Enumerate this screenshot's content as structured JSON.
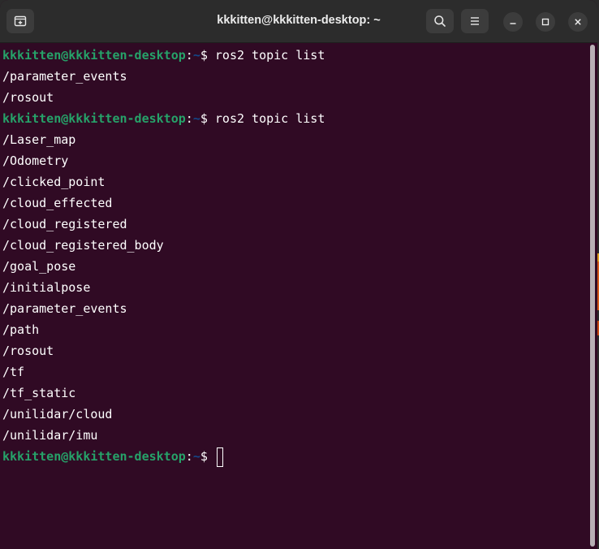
{
  "window": {
    "title": "kkkitten@kkkitten-desktop: ~"
  },
  "titlebar": {
    "new_tab_icon": "new-tab-icon",
    "search_icon": "search-icon",
    "menu_icon": "hamburger-menu-icon",
    "minimize_icon": "minimize-icon",
    "maximize_icon": "maximize-icon",
    "close_icon": "close-icon"
  },
  "prompt": {
    "user_host": "kkkitten@kkkitten-desktop",
    "colon": ":",
    "path": "~",
    "dollar": "$ "
  },
  "terminal": {
    "lines": [
      {
        "type": "prompt",
        "command": "ros2 topic list"
      },
      {
        "type": "output",
        "text": "/parameter_events"
      },
      {
        "type": "output",
        "text": "/rosout"
      },
      {
        "type": "prompt",
        "command": "ros2 topic list"
      },
      {
        "type": "output",
        "text": "/Laser_map"
      },
      {
        "type": "output",
        "text": "/Odometry"
      },
      {
        "type": "output",
        "text": "/clicked_point"
      },
      {
        "type": "output",
        "text": "/cloud_effected"
      },
      {
        "type": "output",
        "text": "/cloud_registered"
      },
      {
        "type": "output",
        "text": "/cloud_registered_body"
      },
      {
        "type": "output",
        "text": "/goal_pose"
      },
      {
        "type": "output",
        "text": "/initialpose"
      },
      {
        "type": "output",
        "text": "/parameter_events"
      },
      {
        "type": "output",
        "text": "/path"
      },
      {
        "type": "output",
        "text": "/rosout"
      },
      {
        "type": "output",
        "text": "/tf"
      },
      {
        "type": "output",
        "text": "/tf_static"
      },
      {
        "type": "output",
        "text": "/unilidar/cloud"
      },
      {
        "type": "output",
        "text": "/unilidar/imu"
      },
      {
        "type": "prompt",
        "command": ""
      }
    ]
  },
  "colors": {
    "background": "#300a24",
    "user_host": "#26a269",
    "path": "#12488b",
    "text": "#ffffff",
    "titlebar": "#2c2c2c"
  }
}
